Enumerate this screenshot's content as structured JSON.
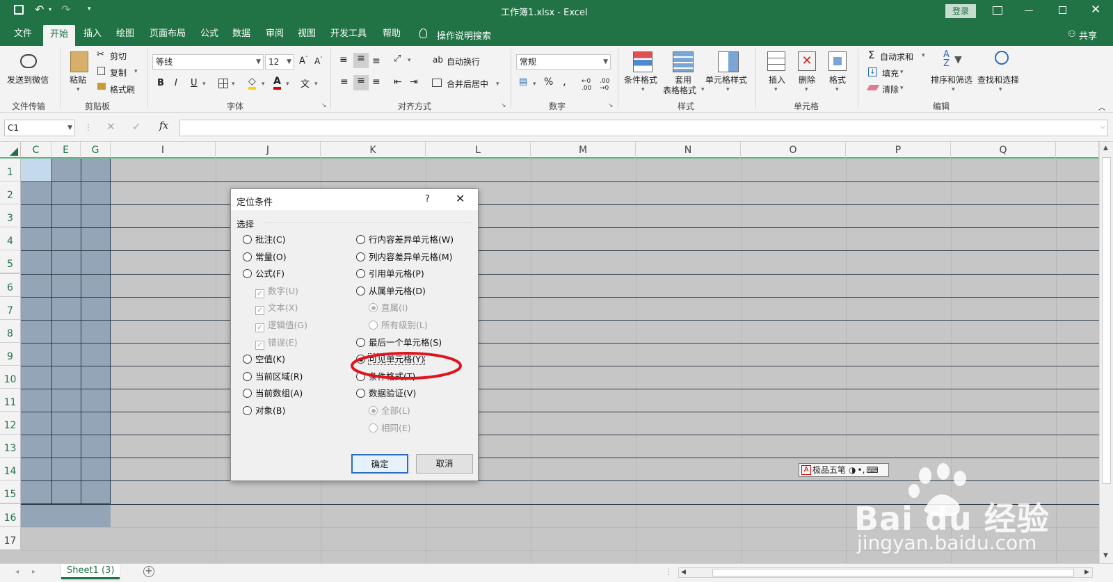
{
  "titlebar": {
    "title": "工作簿1.xlsx  -  Excel",
    "login": "登录"
  },
  "ribbon_tabs": [
    "文件",
    "开始",
    "插入",
    "绘图",
    "页面布局",
    "公式",
    "数据",
    "审阅",
    "视图",
    "开发工具",
    "帮助"
  ],
  "tell_me": "操作说明搜索",
  "share": "共享",
  "ribbon": {
    "wechat": "发送到微信",
    "group_file": "文件传输",
    "paste": "粘贴",
    "cut": "剪切",
    "copy": "复制",
    "format_painter": "格式刷",
    "group_clipboard": "剪贴板",
    "font_name": "等线",
    "font_size": "12",
    "bold": "B",
    "italic": "I",
    "underline": "U",
    "group_font": "字体",
    "wrap": "自动换行",
    "merge": "合并后居中",
    "group_align": "对齐方式",
    "number_format": "常规",
    "group_number": "数字",
    "cond_format": "条件格式",
    "table_format_1": "套用",
    "table_format_2": "表格格式",
    "cell_style": "单元格样式",
    "group_style": "样式",
    "insert": "插入",
    "delete": "删除",
    "format": "格式",
    "group_cells": "单元格",
    "autosum": "自动求和",
    "fill": "填充",
    "clear": "清除",
    "sort": "排序和筛选",
    "find": "查找和选择",
    "group_edit": "编辑"
  },
  "formula_bar": {
    "name_box": "C1",
    "fx": "fx",
    "content": ""
  },
  "columns": [
    "C",
    "E",
    "G",
    "I",
    "J",
    "K",
    "L",
    "M",
    "N",
    "O",
    "P",
    "Q"
  ],
  "rows": [
    "1",
    "2",
    "3",
    "4",
    "5",
    "6",
    "7",
    "8",
    "9",
    "10",
    "11",
    "12",
    "13",
    "14",
    "15",
    "16",
    "17"
  ],
  "sheet_tab": "Sheet1 (3)",
  "dialog": {
    "title": "定位条件",
    "help": "?",
    "section": "选择",
    "left_options": [
      {
        "label": "批注(C)",
        "selected": false,
        "disabled": false
      },
      {
        "label": "常量(O)",
        "selected": false,
        "disabled": false
      },
      {
        "label": "公式(F)",
        "selected": false,
        "disabled": false
      },
      {
        "label": "数字(U)",
        "checked": true,
        "disabled": true
      },
      {
        "label": "文本(X)",
        "checked": true,
        "disabled": true
      },
      {
        "label": "逻辑值(G)",
        "checked": true,
        "disabled": true
      },
      {
        "label": "错误(E)",
        "checked": true,
        "disabled": true
      },
      {
        "label": "空值(K)",
        "selected": false,
        "disabled": false
      },
      {
        "label": "当前区域(R)",
        "selected": false,
        "disabled": false
      },
      {
        "label": "当前数组(A)",
        "selected": false,
        "disabled": false
      },
      {
        "label": "对象(B)",
        "selected": false,
        "disabled": false
      }
    ],
    "right_options": [
      {
        "label": "行内容差异单元格(W)",
        "selected": false,
        "disabled": false
      },
      {
        "label": "列内容差异单元格(M)",
        "selected": false,
        "disabled": false
      },
      {
        "label": "引用单元格(P)",
        "selected": false,
        "disabled": false
      },
      {
        "label": "从属单元格(D)",
        "selected": false,
        "disabled": false
      },
      {
        "label": "直属(I)",
        "selected": true,
        "disabled": true
      },
      {
        "label": "所有级别(L)",
        "selected": false,
        "disabled": true
      },
      {
        "label": "最后一个单元格(S)",
        "selected": false,
        "disabled": false
      },
      {
        "label": "可见单元格(Y)",
        "selected": true,
        "disabled": false
      },
      {
        "label": "条件格式(T)",
        "selected": false,
        "disabled": false
      },
      {
        "label": "数据验证(V)",
        "selected": false,
        "disabled": false
      },
      {
        "label": "全部(L)",
        "selected": true,
        "disabled": true
      },
      {
        "label": "相同(E)",
        "selected": false,
        "disabled": true
      }
    ],
    "ok": "确定",
    "cancel": "取消"
  },
  "ime_bar": {
    "label": "极品五笔"
  },
  "watermark": {
    "brand": "Bai du 经验",
    "url": "jingyan.baidu.com"
  },
  "colors": {
    "excel_green": "#217346",
    "highlight_red": "#e0141e",
    "selected_col": "#95a5b8",
    "active_cell": "#c5d9ec"
  }
}
